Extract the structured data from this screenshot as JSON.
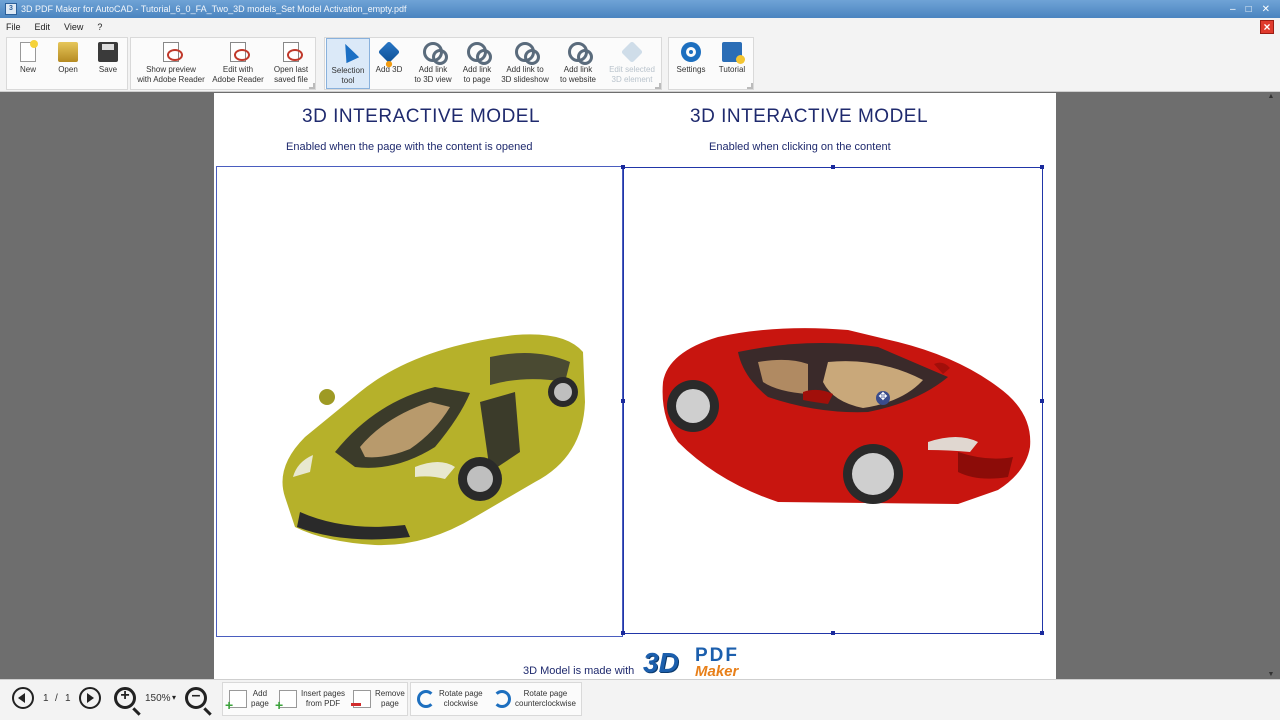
{
  "window": {
    "title": "3D PDF Maker for AutoCAD - Tutorial_6_0_FA_Two_3D models_Set Model Activation_empty.pdf",
    "controls": [
      "minimize-icon",
      "maximize-icon",
      "close-icon"
    ]
  },
  "menu": {
    "items": [
      {
        "label": "File"
      },
      {
        "label": "Edit"
      },
      {
        "label": "View"
      },
      {
        "label": "?"
      }
    ]
  },
  "toolbar": {
    "new": "New",
    "open": "Open",
    "save": "Save",
    "show_preview": "Show preview\nwith Adobe Reader",
    "edit_with": "Edit with\nAdobe Reader",
    "open_last": "Open last\nsaved file",
    "selection_tool": "Selection\ntool",
    "add_3d": "Add 3D",
    "add_link_3d_view": "Add link\nto 3D view",
    "add_link_page": "Add link\nto page",
    "add_link_slideshow": "Add link to\n3D slideshow",
    "add_link_website": "Add link\nto website",
    "edit_selected": "Edit selected\n3D element",
    "settings": "Settings",
    "tutorial": "Tutorial"
  },
  "page": {
    "left_title": "3D INTERACTIVE MODEL",
    "left_subtitle": "Enabled when the page with the content is opened",
    "right_title": "3D INTERACTIVE MODEL",
    "right_subtitle": "Enabled when clicking on the content",
    "footer_text": "3D Model is made with",
    "logo_3d": "3D",
    "logo_pdf": "PDF",
    "logo_maker": "Maker"
  },
  "models": {
    "left_car_color": "#b6b12a",
    "right_car_color": "#c8150f"
  },
  "bottombar": {
    "current_page": "1",
    "separator": "/",
    "total_pages": "1",
    "zoom": "150%",
    "add_page": "Add\npage",
    "insert_pages": "Insert pages\nfrom PDF",
    "remove_page": "Remove\npage",
    "rotate_cw": "Rotate page\nclockwise",
    "rotate_ccw": "Rotate page\ncounterclockwise"
  },
  "colors": {
    "accent": "#1f2a6e",
    "selection": "#2136a8",
    "close": "#e03a2c"
  }
}
